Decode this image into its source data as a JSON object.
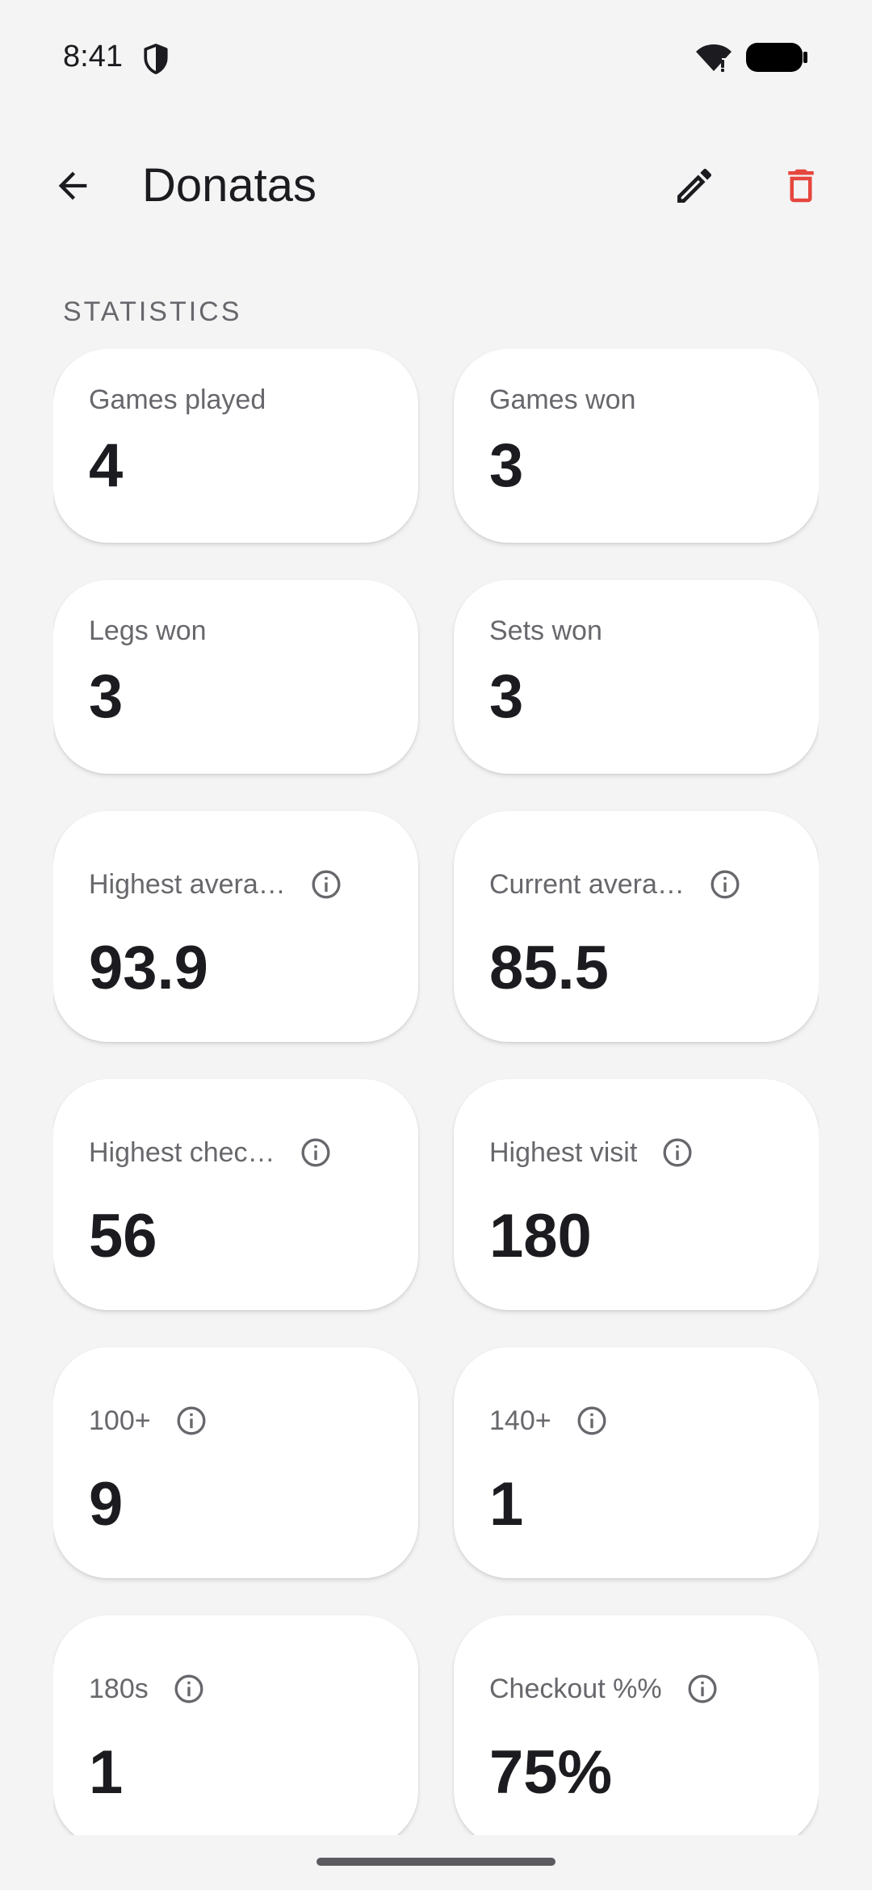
{
  "status_bar": {
    "time": "8:41",
    "icons": [
      "shield-icon",
      "wifi-icon",
      "battery-icon"
    ]
  },
  "app_bar": {
    "title": "Donatas",
    "back_icon": "arrow-back-icon",
    "edit_icon": "pencil-icon",
    "delete_icon": "trash-icon",
    "delete_color": "#e5463e"
  },
  "section": {
    "title": "STATISTICS"
  },
  "stats": [
    {
      "label": "Games played",
      "value": "4",
      "info": false
    },
    {
      "label": "Games won",
      "value": "3",
      "info": false
    },
    {
      "label": "Legs won",
      "value": "3",
      "info": false
    },
    {
      "label": "Sets won",
      "value": "3",
      "info": false
    },
    {
      "label": "Highest avera…",
      "value": "93.9",
      "info": true
    },
    {
      "label": "Current avera…",
      "value": "85.5",
      "info": true
    },
    {
      "label": "Highest chec…",
      "value": "56",
      "info": true
    },
    {
      "label": "Highest visit",
      "value": "180",
      "info": true
    },
    {
      "label": "100+",
      "value": "9",
      "info": true
    },
    {
      "label": "140+",
      "value": "1",
      "info": true
    },
    {
      "label": "180s",
      "value": "1",
      "info": true
    },
    {
      "label": "Checkout %%",
      "value": "75%",
      "info": true
    }
  ]
}
